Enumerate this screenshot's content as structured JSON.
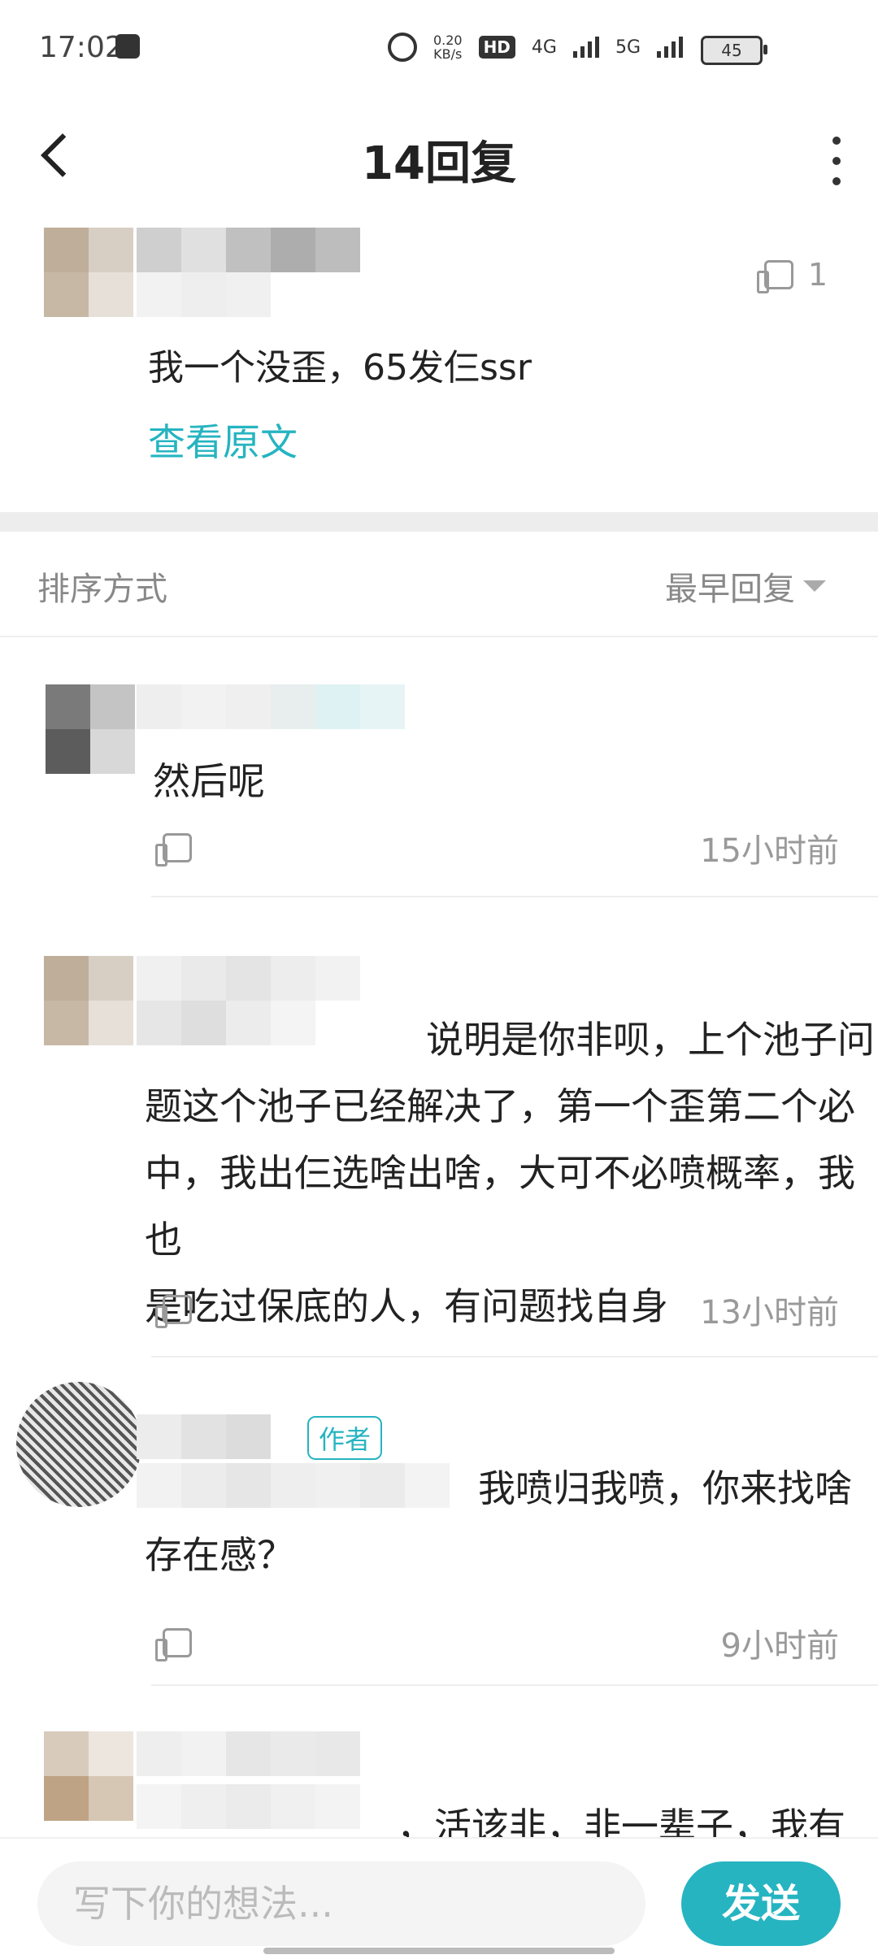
{
  "status": {
    "time": "17:02",
    "net_speed_value": "0.20",
    "net_speed_unit": "KB/s",
    "hd": "HD",
    "network_1": "4G",
    "network_2": "5G",
    "battery": "45"
  },
  "header": {
    "title": "14回复"
  },
  "post": {
    "like_count": "1",
    "text": "我一个没歪，65发仨ssr",
    "view_original": "查看原文"
  },
  "sort": {
    "label": "排序方式",
    "value": "最早回复"
  },
  "replies": [
    {
      "lines": [
        "然后呢"
      ],
      "time": "15小时前"
    },
    {
      "lines": [
        "说明是你非呗，上个池子问",
        "题这个池子已经解决了，第一个歪第二个必",
        "中，我出仨选啥出啥，大可不必喷概率，我也",
        "是吃过保底的人，有问题找自身"
      ],
      "time": "13小时前"
    },
    {
      "tag": "作者",
      "lines": [
        "我喷归我喷，你来找啥",
        "存在感？"
      ],
      "time": "9小时前"
    },
    {
      "lines": [
        "，活该非，非一辈子，我有资"
      ]
    }
  ],
  "input": {
    "placeholder": "写下你的想法...",
    "send_label": "发送"
  },
  "colors": {
    "accent": "#26b4c1"
  }
}
